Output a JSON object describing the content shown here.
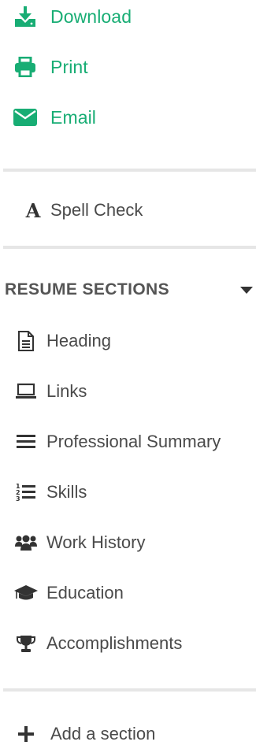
{
  "actions": {
    "download_label": "Download",
    "print_label": "Print",
    "email_label": "Email"
  },
  "tools": {
    "spell_check_label": "Spell Check"
  },
  "resume_sections": {
    "title": "RESUME SECTIONS",
    "items": [
      {
        "label": "Heading",
        "icon": "document-icon"
      },
      {
        "label": "Links",
        "icon": "laptop-icon"
      },
      {
        "label": "Professional Summary",
        "icon": "bars-icon"
      },
      {
        "label": "Skills",
        "icon": "numbered-list-icon"
      },
      {
        "label": "Work History",
        "icon": "users-icon"
      },
      {
        "label": "Education",
        "icon": "graduation-cap-icon"
      },
      {
        "label": "Accomplishments",
        "icon": "trophy-icon"
      }
    ]
  },
  "add_section_label": "Add a section",
  "colors": {
    "accent": "#18ad74",
    "text": "#4a4a4a",
    "divider": "#e6e6e6"
  }
}
